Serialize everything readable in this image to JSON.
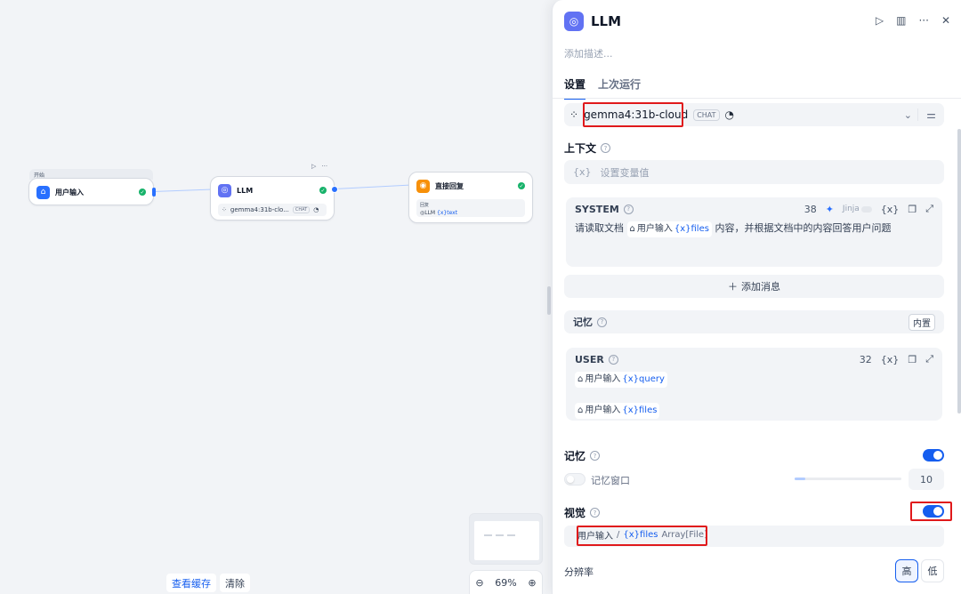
{
  "canvas": {
    "start_label": "开始",
    "node_start": {
      "title": "用户输入"
    },
    "node_llm": {
      "title": "LLM",
      "model": "gemma4:31b-clo...",
      "mode": "CHAT"
    },
    "node_answer": {
      "title": "直接回复",
      "field_label": "回复",
      "var_source": "LLM",
      "var_name": "{x}text"
    },
    "zoom": "69%",
    "view_cache": "查看缓存",
    "clear": "清除"
  },
  "panel": {
    "title": "LLM",
    "description_placeholder": "添加描述...",
    "tabs": [
      "设置",
      "上次运行"
    ],
    "model": {
      "name": "gemma4:31b-cloud",
      "mode": "CHAT"
    },
    "context": {
      "label": "上下文",
      "placeholder": "设置变量值",
      "var_icon": "{x}"
    },
    "system": {
      "role": "SYSTEM",
      "count": "38",
      "jinja": "Jinja",
      "var_icon": "{x}",
      "text_before": "请读取文档",
      "chip_node": "用户输入",
      "chip_var": "{x}files",
      "text_after": "内容，并根据文档中的内容回答用户问题"
    },
    "add_message": "添加消息",
    "memory_section": {
      "label": "记忆",
      "badge": "内置"
    },
    "user": {
      "role": "USER",
      "count": "32",
      "var_icon": "{x}",
      "chip1_node": "用户输入",
      "chip1_var": "{x}query",
      "chip2_node": "用户输入",
      "chip2_var": "{x}files"
    },
    "memory": {
      "label": "记忆",
      "enabled": true,
      "window_label": "记忆窗口",
      "window_value": "10",
      "window_fill": 0.1
    },
    "vision": {
      "label": "视觉",
      "enabled": true,
      "node": "用户输入",
      "sep": "/",
      "var": "{x}files",
      "type": "Array[File]"
    },
    "resolution": {
      "label": "分辨率",
      "high": "高",
      "low": "低",
      "selected": "高"
    }
  },
  "colors": {
    "accent": "#155eef",
    "highlight": "#e0191b",
    "success": "#17b26a"
  }
}
